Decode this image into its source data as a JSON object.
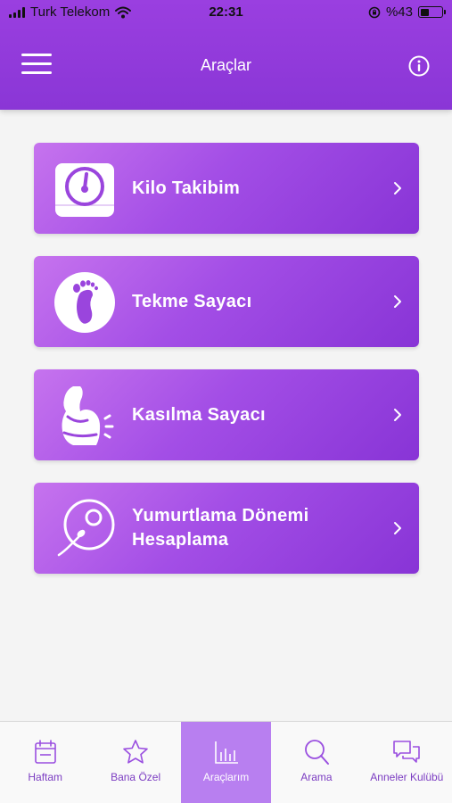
{
  "status_bar": {
    "carrier": "Turk Telekom",
    "time": "22:31",
    "battery": "%43",
    "battery_level": 0.43
  },
  "header": {
    "title": "Araçlar",
    "menu_icon": "hamburger-menu-icon",
    "info_icon": "info-icon"
  },
  "tools": [
    {
      "label": "Kilo Takibim",
      "icon": "scale-icon"
    },
    {
      "label": "Tekme Sayacı",
      "icon": "baby-foot-icon"
    },
    {
      "label": "Kasılma Sayacı",
      "icon": "pregnant-belly-icon"
    },
    {
      "label": "Yumurtlama Dönemi Hesaplama",
      "icon": "ovulation-egg-icon"
    }
  ],
  "tabs": [
    {
      "label": "Haftam",
      "icon": "calendar-icon",
      "active": false
    },
    {
      "label": "Bana Özel",
      "icon": "star-icon",
      "active": false
    },
    {
      "label": "Araçlarım",
      "icon": "bar-chart-icon",
      "active": true
    },
    {
      "label": "Arama",
      "icon": "search-icon",
      "active": false
    },
    {
      "label": "Anneler Kulübü",
      "icon": "chat-bubbles-icon",
      "active": false
    }
  ],
  "colors": {
    "header": "#9a3fe0",
    "card_start": "#c673ee",
    "card_end": "#8834d6",
    "tab_active": "#b87ff0",
    "tab_label": "#7c3dc2"
  }
}
